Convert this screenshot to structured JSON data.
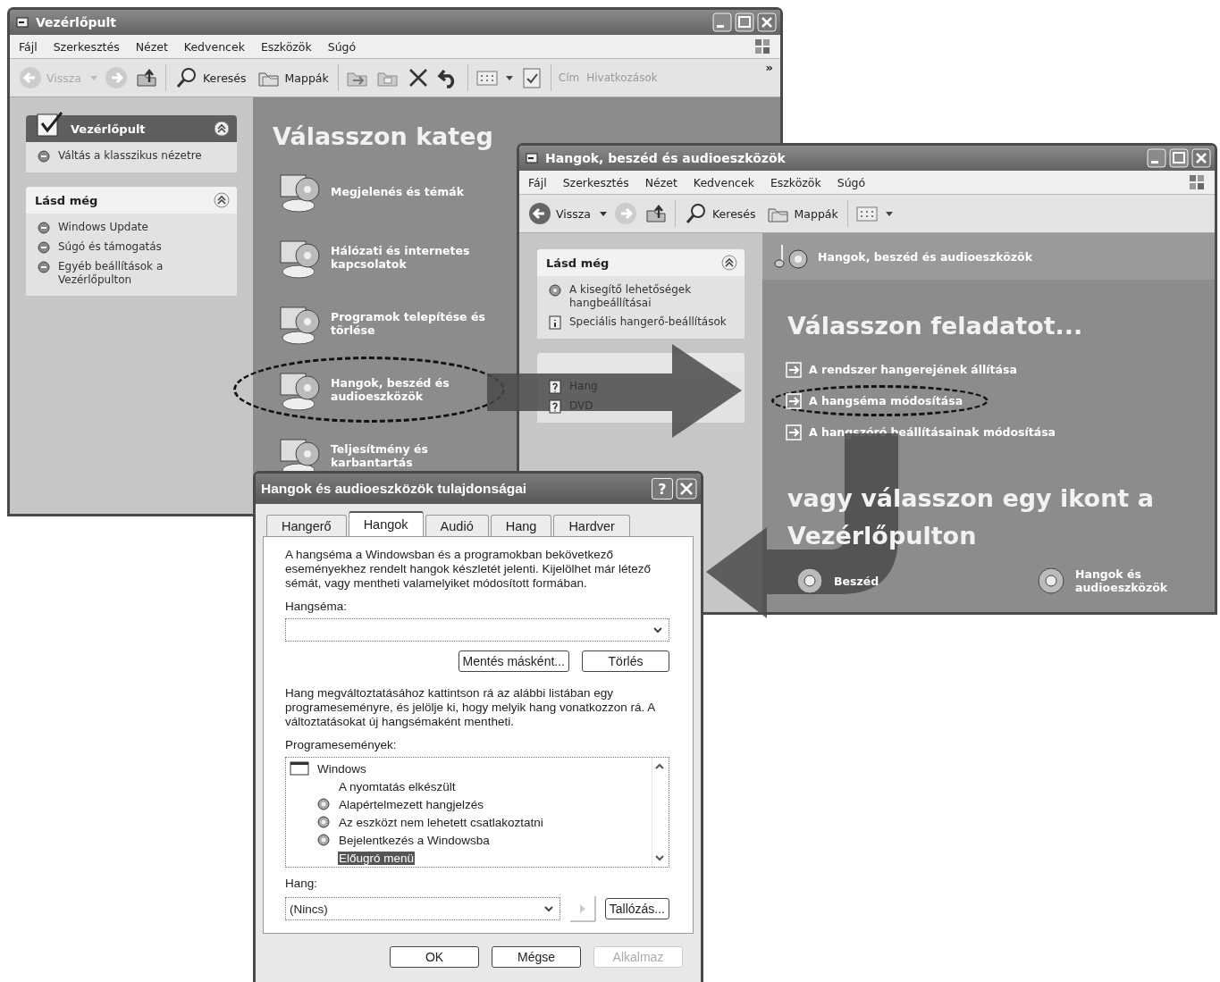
{
  "control_panel_window": {
    "title": "Vezérlőpult",
    "menu": [
      "Fájl",
      "Szerkesztés",
      "Nézet",
      "Kedvencek",
      "Eszközök",
      "Súgó"
    ],
    "toolbar": {
      "back": {
        "label": "Vissza",
        "disabled": true
      },
      "search": "Keresés",
      "folders": "Mappák",
      "address": {
        "label": "Cím",
        "disabled": true
      },
      "links": "Hivatkozások",
      "more": "»"
    },
    "side_panels": [
      {
        "title": "Vezérlőpult",
        "kind": "header",
        "items": [
          "Váltás a klasszikus nézetre"
        ]
      },
      {
        "title": "Lásd még",
        "kind": "plain",
        "items": [
          "Windows Update",
          "Súgó és támogatás",
          "Egyéb beállítások a Vezérlőpulton"
        ]
      }
    ],
    "heading": "Válasszon kateg",
    "categories": [
      {
        "label": "Megjelenés és témák",
        "highlighted": false
      },
      {
        "label": "Hálózati és internetes kapcsolatok",
        "highlighted": false
      },
      {
        "label": "Programok telepítése és törlése",
        "highlighted": false
      },
      {
        "label": "Hangok, beszéd és audioeszközök",
        "highlighted": true
      },
      {
        "label": "Teljesítmény és karbantartás",
        "highlighted": false
      }
    ]
  },
  "category_window": {
    "title": "Hangok, beszéd és audioeszközök",
    "menu": [
      "Fájl",
      "Szerkesztés",
      "Nézet",
      "Kedvencek",
      "Eszközök",
      "Súgó"
    ],
    "toolbar": {
      "back": {
        "label": "Vissza",
        "disabled": false
      },
      "search": "Keresés",
      "folders": "Mappák"
    },
    "side_panels": [
      {
        "title": "Lásd még",
        "items": [
          {
            "label": "A kisegítő lehetőségek hangbeállításai",
            "kind": "sound"
          },
          {
            "label": "Speciális hangerő-beállítások",
            "kind": "info"
          }
        ]
      },
      {
        "items": [
          {
            "label": "Hang",
            "kind": "help"
          },
          {
            "label": "DVD",
            "kind": "help"
          }
        ]
      }
    ],
    "header": "Hangok, beszéd és audioeszközök",
    "heading": "Válasszon feladatot...",
    "tasks": [
      {
        "label": "A rendszer hangerejének állítása",
        "highlighted": false
      },
      {
        "label": "A hangséma módosítása",
        "highlighted": true
      },
      {
        "label": "A hangszóró beállításainak módosítása",
        "highlighted": false
      }
    ],
    "or_heading": "vagy válasszon egy ikont a Vezérlőpulton",
    "icons": [
      "Beszéd",
      "Hangok és audioeszközök"
    ]
  },
  "properties_dialog": {
    "title": "Hangok és audioeszközök tulajdonságai",
    "help_button": "?",
    "tabs": [
      {
        "label": "Hangerő",
        "selected": false
      },
      {
        "label": "Hangok",
        "selected": true
      },
      {
        "label": "Audió",
        "selected": false
      },
      {
        "label": "Hang",
        "selected": false
      },
      {
        "label": "Hardver",
        "selected": false
      }
    ],
    "intro": "A hangséma a Windowsban és a programokban bekövetkező eseményekhez rendelt hangok készletét jelenti. Kijelölhet már létező sémát, vagy mentheti valamelyiket módosított formában.",
    "scheme_label": "Hangséma:",
    "scheme_buttons": [
      "Mentés másként...",
      "Törlés"
    ],
    "instructions": "Hang megváltoztatásához kattintson rá az alábbi listában egy programeseményre, és jelölje ki, hogy melyik hang vonatkozzon rá. A változtatásokat új hangsémaként mentheti.",
    "events_label": "Programesemények:",
    "events": [
      {
        "label": "Windows",
        "selected": false,
        "children": [
          {
            "label": "A nyomtatás elkészült",
            "has_sound": false,
            "selected": false
          },
          {
            "label": "Alapértelmezett hangjelzés",
            "has_sound": true,
            "selected": false
          },
          {
            "label": "Az eszközt nem lehetett csatlakoztatni",
            "has_sound": true,
            "selected": false
          },
          {
            "label": "Bejelentkezés a Windowsba",
            "has_sound": true,
            "selected": false
          },
          {
            "label": "Előugró menü",
            "has_sound": false,
            "selected": true
          }
        ]
      }
    ],
    "sound_label": "Hang:",
    "sound_value": "(Nincs)",
    "browse_button": "Tallózás...",
    "footer_buttons": [
      {
        "label": "OK",
        "disabled": false
      },
      {
        "label": "Mégse",
        "disabled": false
      },
      {
        "label": "Alkalmaz",
        "disabled": true
      }
    ]
  }
}
